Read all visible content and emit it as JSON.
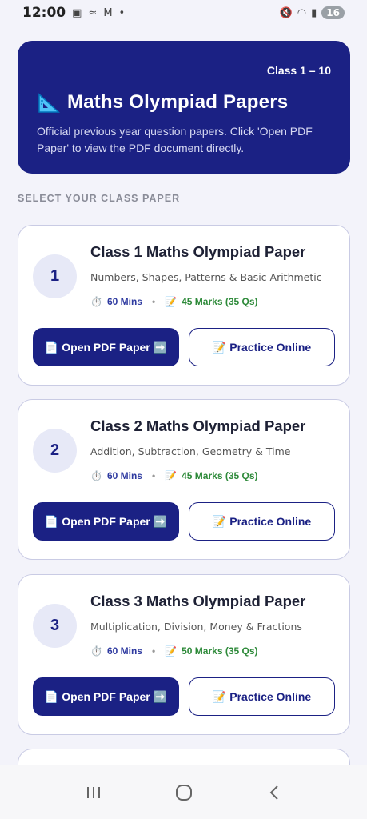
{
  "status_bar": {
    "time": "12:00",
    "battery": "16"
  },
  "header": {
    "class_range": "Class 1 – 10",
    "title": "Maths Olympiad Papers",
    "subtitle": "Official previous year question papers. Click 'Open PDF Paper' to view the PDF document directly.",
    "accent_color": "#1b2184"
  },
  "section_label": "SELECT YOUR CLASS PAPER",
  "papers": [
    {
      "number": "1",
      "title": "Class 1 Maths Olympiad Paper",
      "topics": "Numbers, Shapes, Patterns & Basic Arithmetic",
      "duration": "60 Mins",
      "marks": "45 Marks (35 Qs)",
      "open_label": "Open PDF Paper",
      "practice_label": "Practice Online"
    },
    {
      "number": "2",
      "title": "Class 2 Maths Olympiad Paper",
      "topics": "Addition, Subtraction, Geometry & Time",
      "duration": "60 Mins",
      "marks": "45 Marks (35 Qs)",
      "open_label": "Open PDF Paper",
      "practice_label": "Practice Online"
    },
    {
      "number": "3",
      "title": "Class 3 Maths Olympiad Paper",
      "topics": "Multiplication, Division, Money & Fractions",
      "duration": "60 Mins",
      "marks": "50 Marks (35 Qs)",
      "open_label": "Open PDF Paper",
      "practice_label": "Practice Online"
    }
  ],
  "icons": {
    "header": "triangle-ruler-icon",
    "duration": "stopwatch-icon",
    "marks": "memo-icon",
    "open": "document-icon",
    "open_arrow": "right-arrow-icon",
    "practice": "memo-icon"
  }
}
